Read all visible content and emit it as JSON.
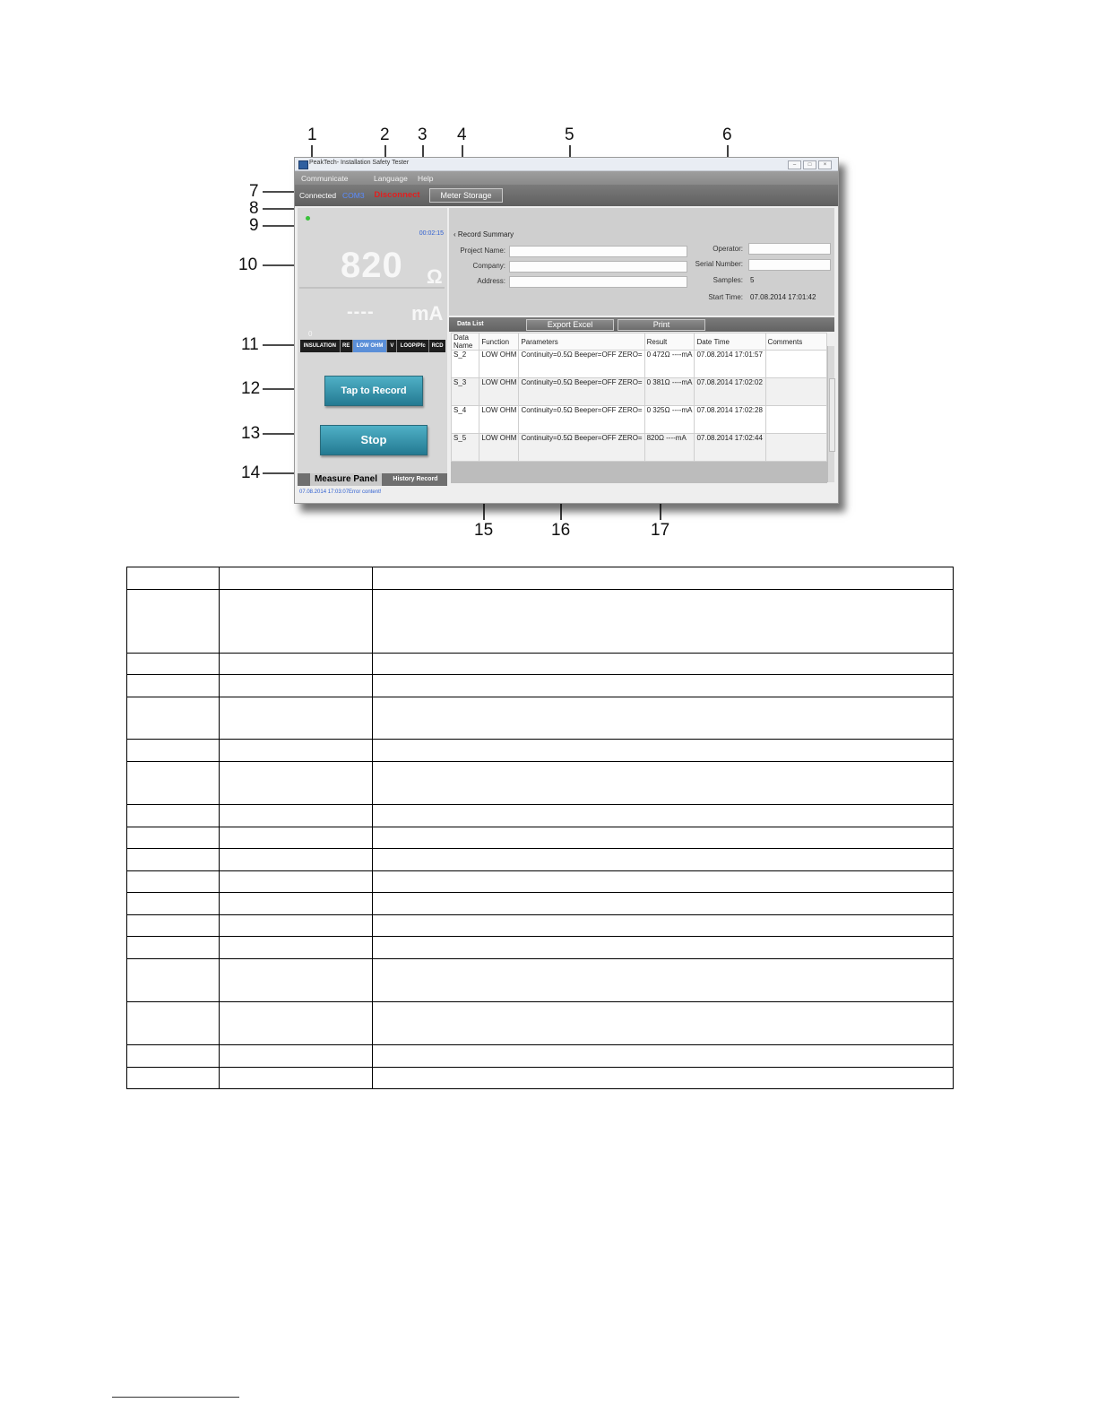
{
  "callouts": [
    "1",
    "2",
    "3",
    "4",
    "5",
    "6",
    "7",
    "8",
    "9",
    "10",
    "11",
    "12",
    "13",
    "14",
    "15",
    "16",
    "17"
  ],
  "window": {
    "title": "PeakTech- Installation Safety Tester",
    "menu": [
      "Communicate",
      "Language",
      "Help"
    ],
    "toolbar": {
      "status": "Connected",
      "port": "COM3",
      "disconnect_label": "Disconnect",
      "meter_storage_label": "Meter Storage"
    },
    "measure_panel": {
      "timer": "00:02:15",
      "reading_main": "820",
      "unit_main": "Ω",
      "reading_sub": "----",
      "unit_sub": "mA",
      "small_mark": "0",
      "functions": [
        "INSULATION",
        "RE",
        "LOW OHM",
        "V",
        "LOOP/Pfc",
        "RCD"
      ],
      "active_function": "LOW OHM",
      "record_label": "Tap to Record",
      "stop_label": "Stop",
      "tabs": [
        "Measure Panel",
        "History Record"
      ]
    },
    "statusbar": "07.08.2014 17:03:07Error content!",
    "summary": {
      "title": "Record Summary",
      "project_label": "Project Name:",
      "company_label": "Company:",
      "address_label": "Address:",
      "operator_label": "Operator:",
      "serial_label": "Serial Number:",
      "samples_label": "Samples:",
      "samples_value": "5",
      "start_label": "Start Time:",
      "start_value": "07.08.2014 17:01:42"
    },
    "datalist": {
      "title": "Data List",
      "export_label": "Export Excel",
      "print_label": "Print",
      "columns": [
        "Data Name",
        "Function",
        "Parameters",
        "Result",
        "Date Time",
        "Comments"
      ],
      "rows": [
        {
          "name": "S_2",
          "function": "LOW OHM",
          "parameters": "Continuity=0.5Ω\nBeeper=OFF\nZERO=",
          "result": "0\n472Ω\n----mA",
          "datetime": "07.08.2014 17:01:57",
          "comments": ""
        },
        {
          "name": "S_3",
          "function": "LOW OHM",
          "parameters": "Continuity=0.5Ω\nBeeper=OFF\nZERO=",
          "result": "0\n381Ω\n----mA",
          "datetime": "07.08.2014 17:02:02",
          "comments": ""
        },
        {
          "name": "S_4",
          "function": "LOW OHM",
          "parameters": "Continuity=0.5Ω\nBeeper=OFF\nZERO=",
          "result": "0\n325Ω\n----mA",
          "datetime": "07.08.2014 17:02:28",
          "comments": ""
        },
        {
          "name": "S_5",
          "function": "LOW OHM",
          "parameters": "Continuity=0.5Ω\nBeeper=OFF\nZERO=",
          "result": "820Ω\n----mA",
          "datetime": "07.08.2014 17:02:44",
          "comments": ""
        }
      ]
    }
  }
}
